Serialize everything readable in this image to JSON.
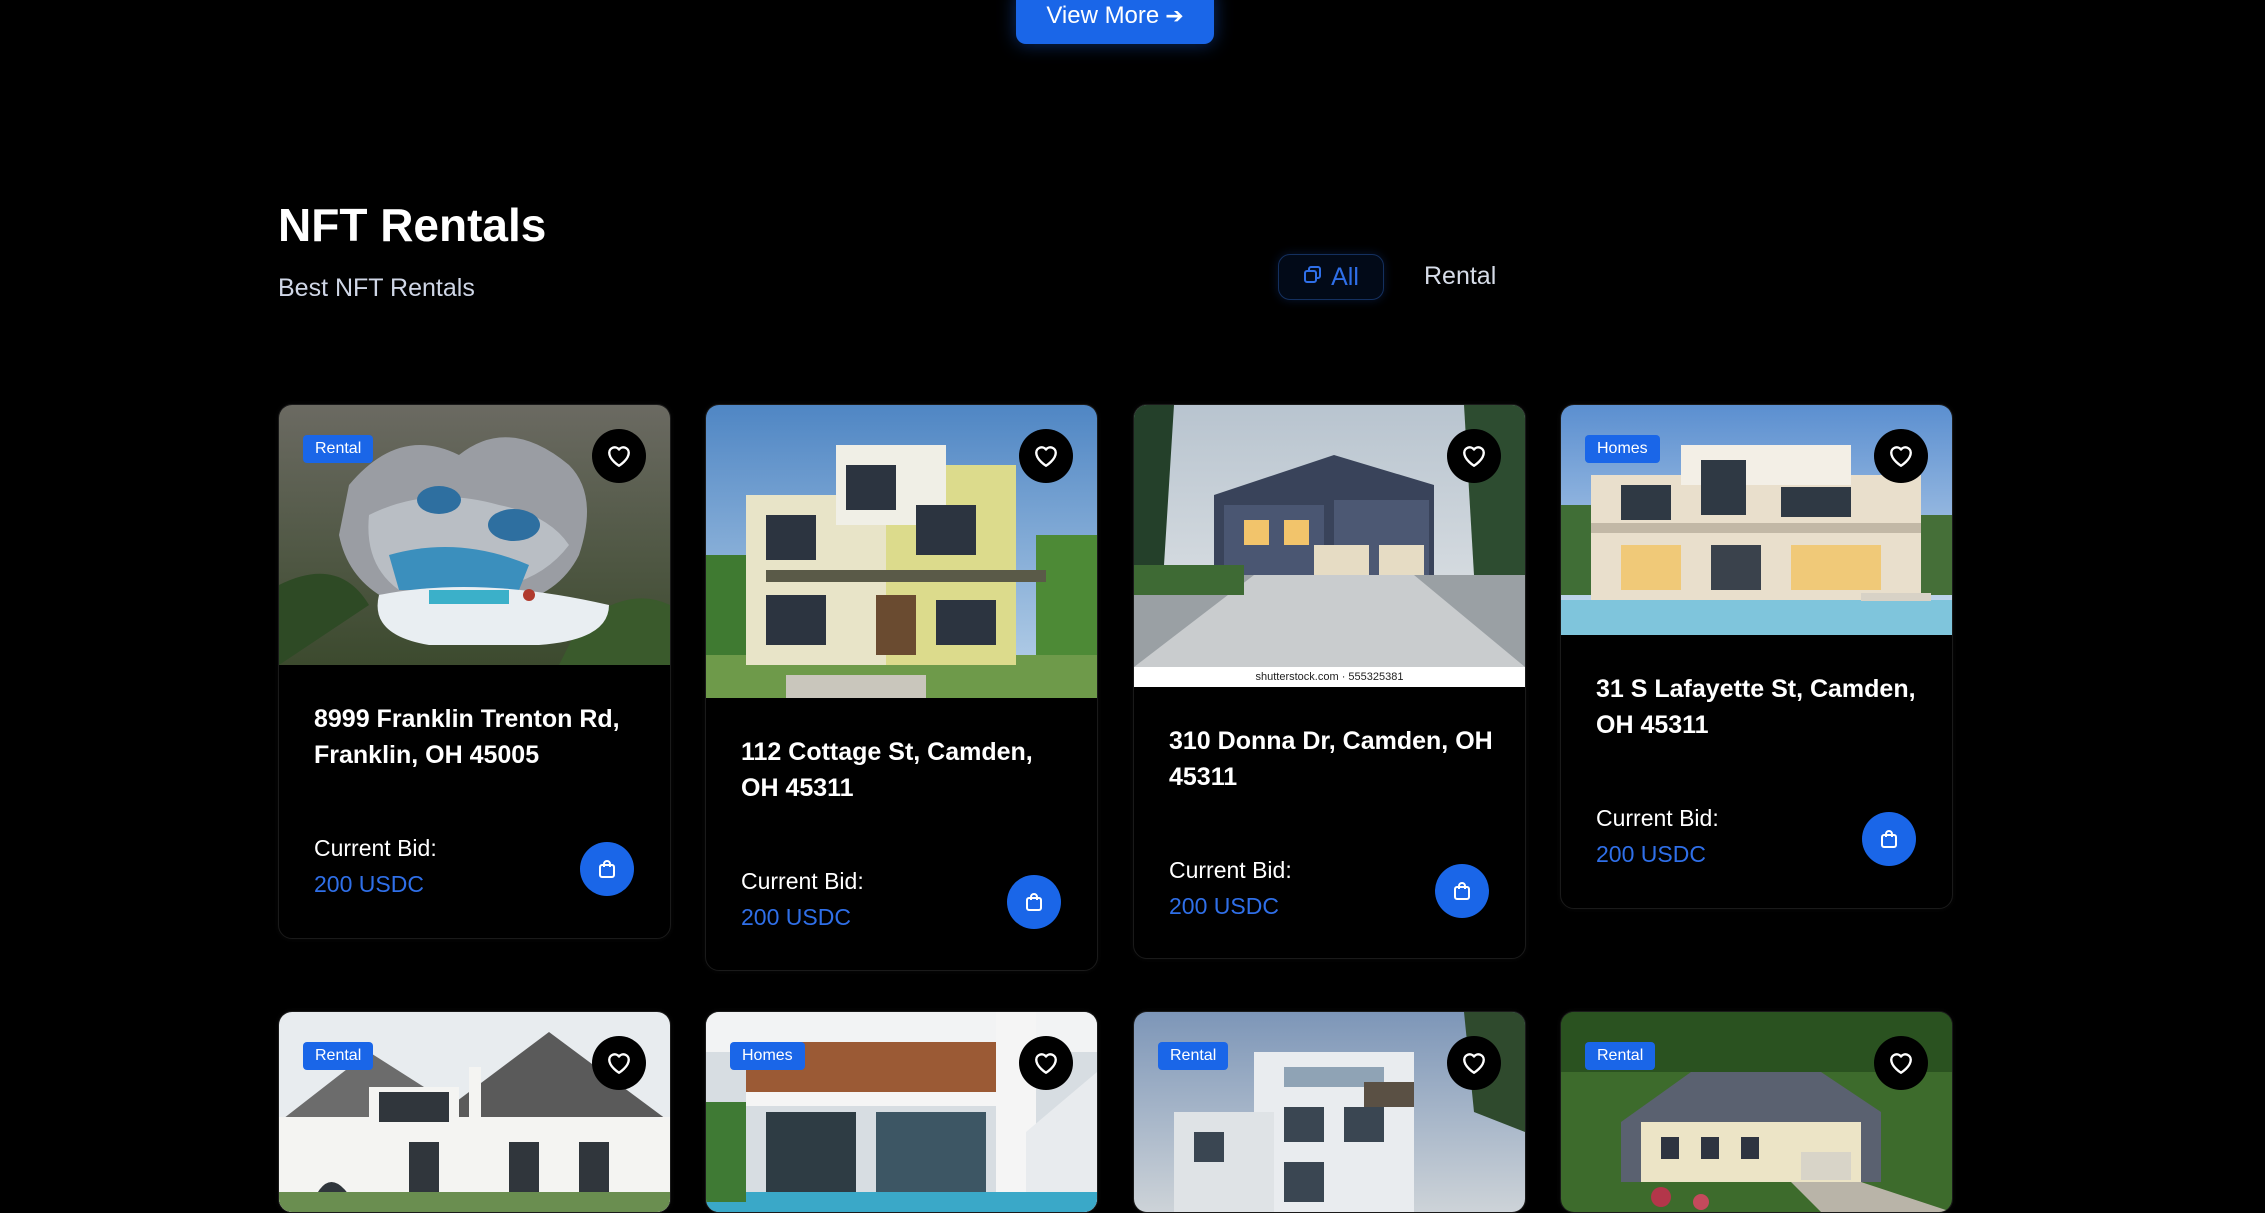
{
  "top": {
    "view_more_label": "View More",
    "view_more_arrow": "➔"
  },
  "section": {
    "title": "NFT Rentals",
    "subtitle": "Best NFT Rentals"
  },
  "filters": {
    "all_label": "All",
    "rental_label": "Rental",
    "active": "All"
  },
  "cards": [
    {
      "badge": "Rental",
      "title": "8999 Franklin Trenton Rd, Franklin, OH 45005",
      "bid_label": "Current Bid:",
      "bid_value": "200 USDC"
    },
    {
      "badge": "",
      "title": "112 Cottage St, Camden, OH 45311",
      "bid_label": "Current Bid:",
      "bid_value": "200 USDC"
    },
    {
      "badge": "",
      "title": "310 Donna Dr, Camden, OH 45311",
      "bid_label": "Current Bid:",
      "bid_value": "200 USDC",
      "watermark": "shutterstock.com · 555325381"
    },
    {
      "badge": "Homes",
      "title": "31 S Lafayette St, Camden, OH 45311",
      "bid_label": "Current Bid:",
      "bid_value": "200 USDC"
    },
    {
      "badge": "Rental"
    },
    {
      "badge": "Homes"
    },
    {
      "badge": "Rental"
    },
    {
      "badge": "Rental"
    }
  ],
  "icons": {
    "heart": "heart-icon",
    "buy": "shopping-bag-icon",
    "all": "copy-icon"
  },
  "colors": {
    "accent": "#1a66e8",
    "price": "#2f6fe8",
    "background": "#000000"
  }
}
